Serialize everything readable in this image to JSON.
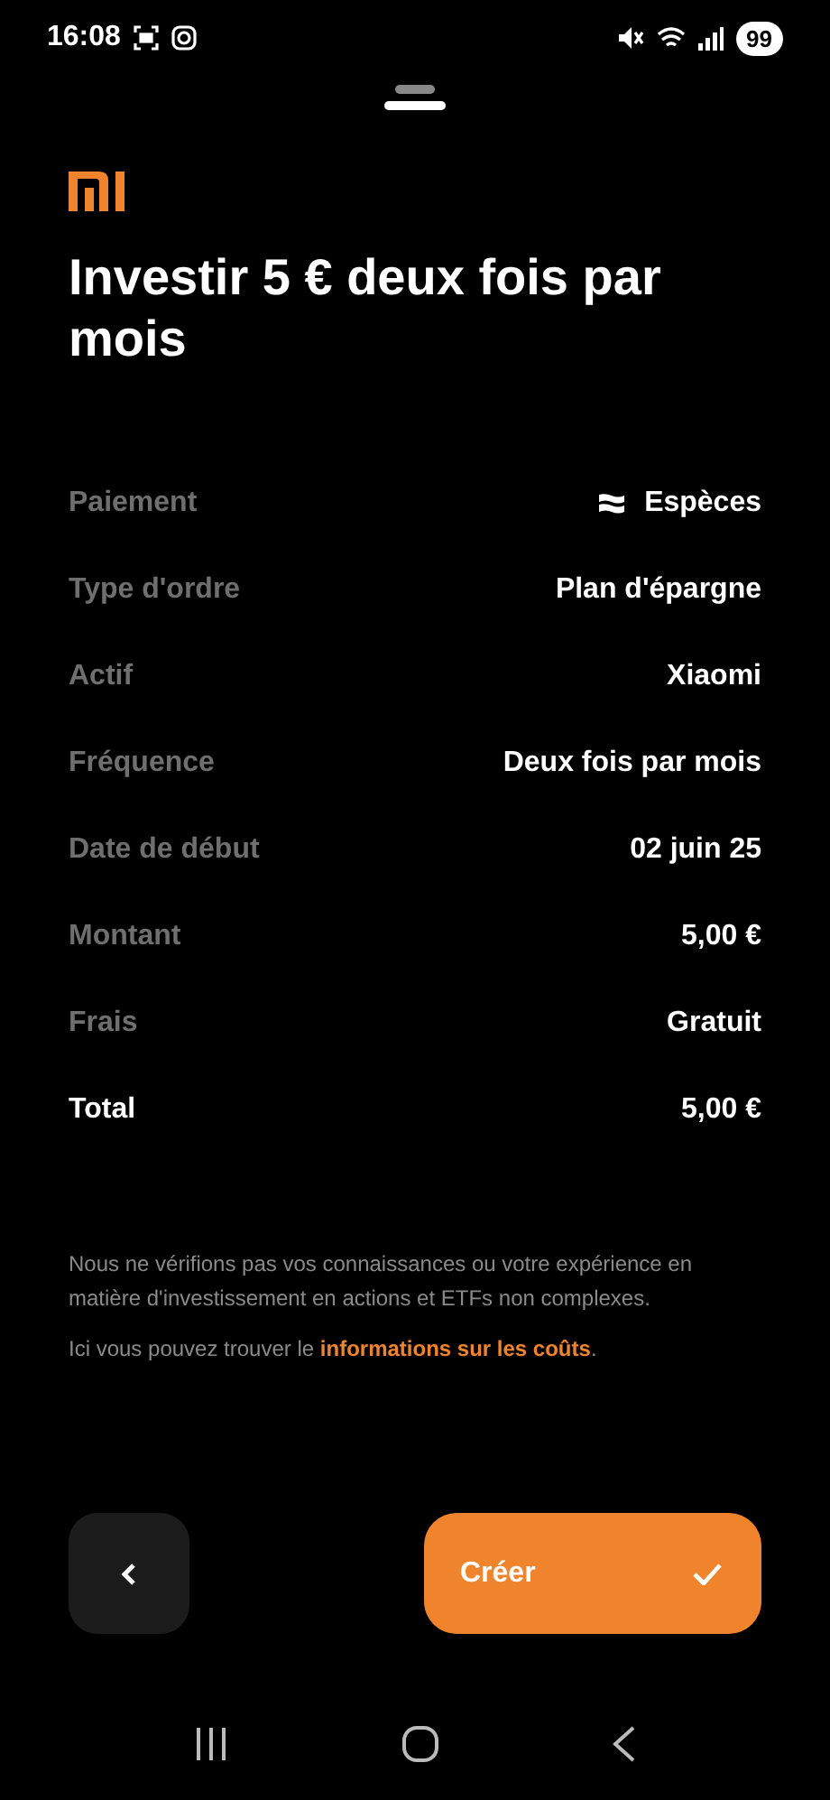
{
  "status_bar": {
    "time": "16:08",
    "battery": "99"
  },
  "title": "Investir 5 € deux fois par mois",
  "rows": [
    {
      "kind": "payment",
      "label": "Paiement",
      "value": "Espèces"
    },
    {
      "kind": "detail",
      "label": "Type d'ordre",
      "value": "Plan d'épargne"
    },
    {
      "kind": "detail",
      "label": "Actif",
      "value": "Xiaomi"
    },
    {
      "kind": "detail",
      "label": "Fréquence",
      "value": "Deux fois par mois"
    },
    {
      "kind": "detail",
      "label": "Date de début",
      "value": "02 juin 25"
    },
    {
      "kind": "detail",
      "label": "Montant",
      "value": "5,00 €"
    },
    {
      "kind": "detail",
      "label": "Frais",
      "value": "Gratuit"
    },
    {
      "kind": "total",
      "label": "Total",
      "value": "5,00 €"
    }
  ],
  "disclaimer": "Nous ne vérifions pas vos connaissances ou votre expérience en matière d'investissement en actions et ETFs non complexes.",
  "costs_note": {
    "before": "Ici vous pouvez trouver le ",
    "link": "informations sur les coûts",
    "after": "."
  },
  "create_button": {
    "label": "Créer"
  }
}
